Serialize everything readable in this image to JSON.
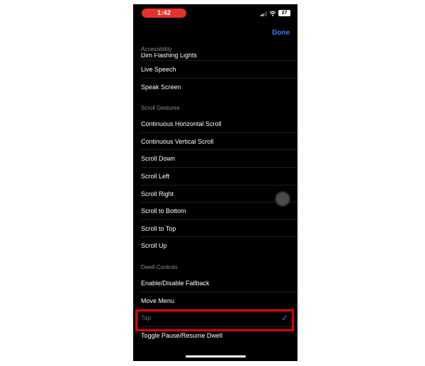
{
  "status_bar": {
    "time": "1:42",
    "battery": "27"
  },
  "nav": {
    "done_label": "Done"
  },
  "sections": {
    "accessibility": {
      "header": "Accessibility",
      "items": [
        "Dim Flashing Lights",
        "Live Speech",
        "Speak Screen"
      ]
    },
    "scroll_gestures": {
      "header": "Scroll Gestures",
      "items": [
        "Continuous Horizontal Scroll",
        "Continuous Vertical Scroll",
        "Scroll Down",
        "Scroll Left",
        "Scroll Right",
        "Scroll to Bottom",
        "Scroll to Top",
        "Scroll Up"
      ]
    },
    "dwell_controls": {
      "header": "Dwell Controls",
      "items": [
        "Enable/Disable Fallback",
        "Move Menu",
        "Tap",
        "Toggle Pause/Resume Dwell"
      ],
      "selected": "Tap"
    }
  },
  "colors": {
    "accent": "#2f7fe0",
    "highlight": "#e00000",
    "time_pill": "#e5322a"
  },
  "icons": [
    "signal-icon",
    "wifi-icon",
    "battery-icon",
    "checkmark-icon",
    "assistive-touch-icon"
  ]
}
